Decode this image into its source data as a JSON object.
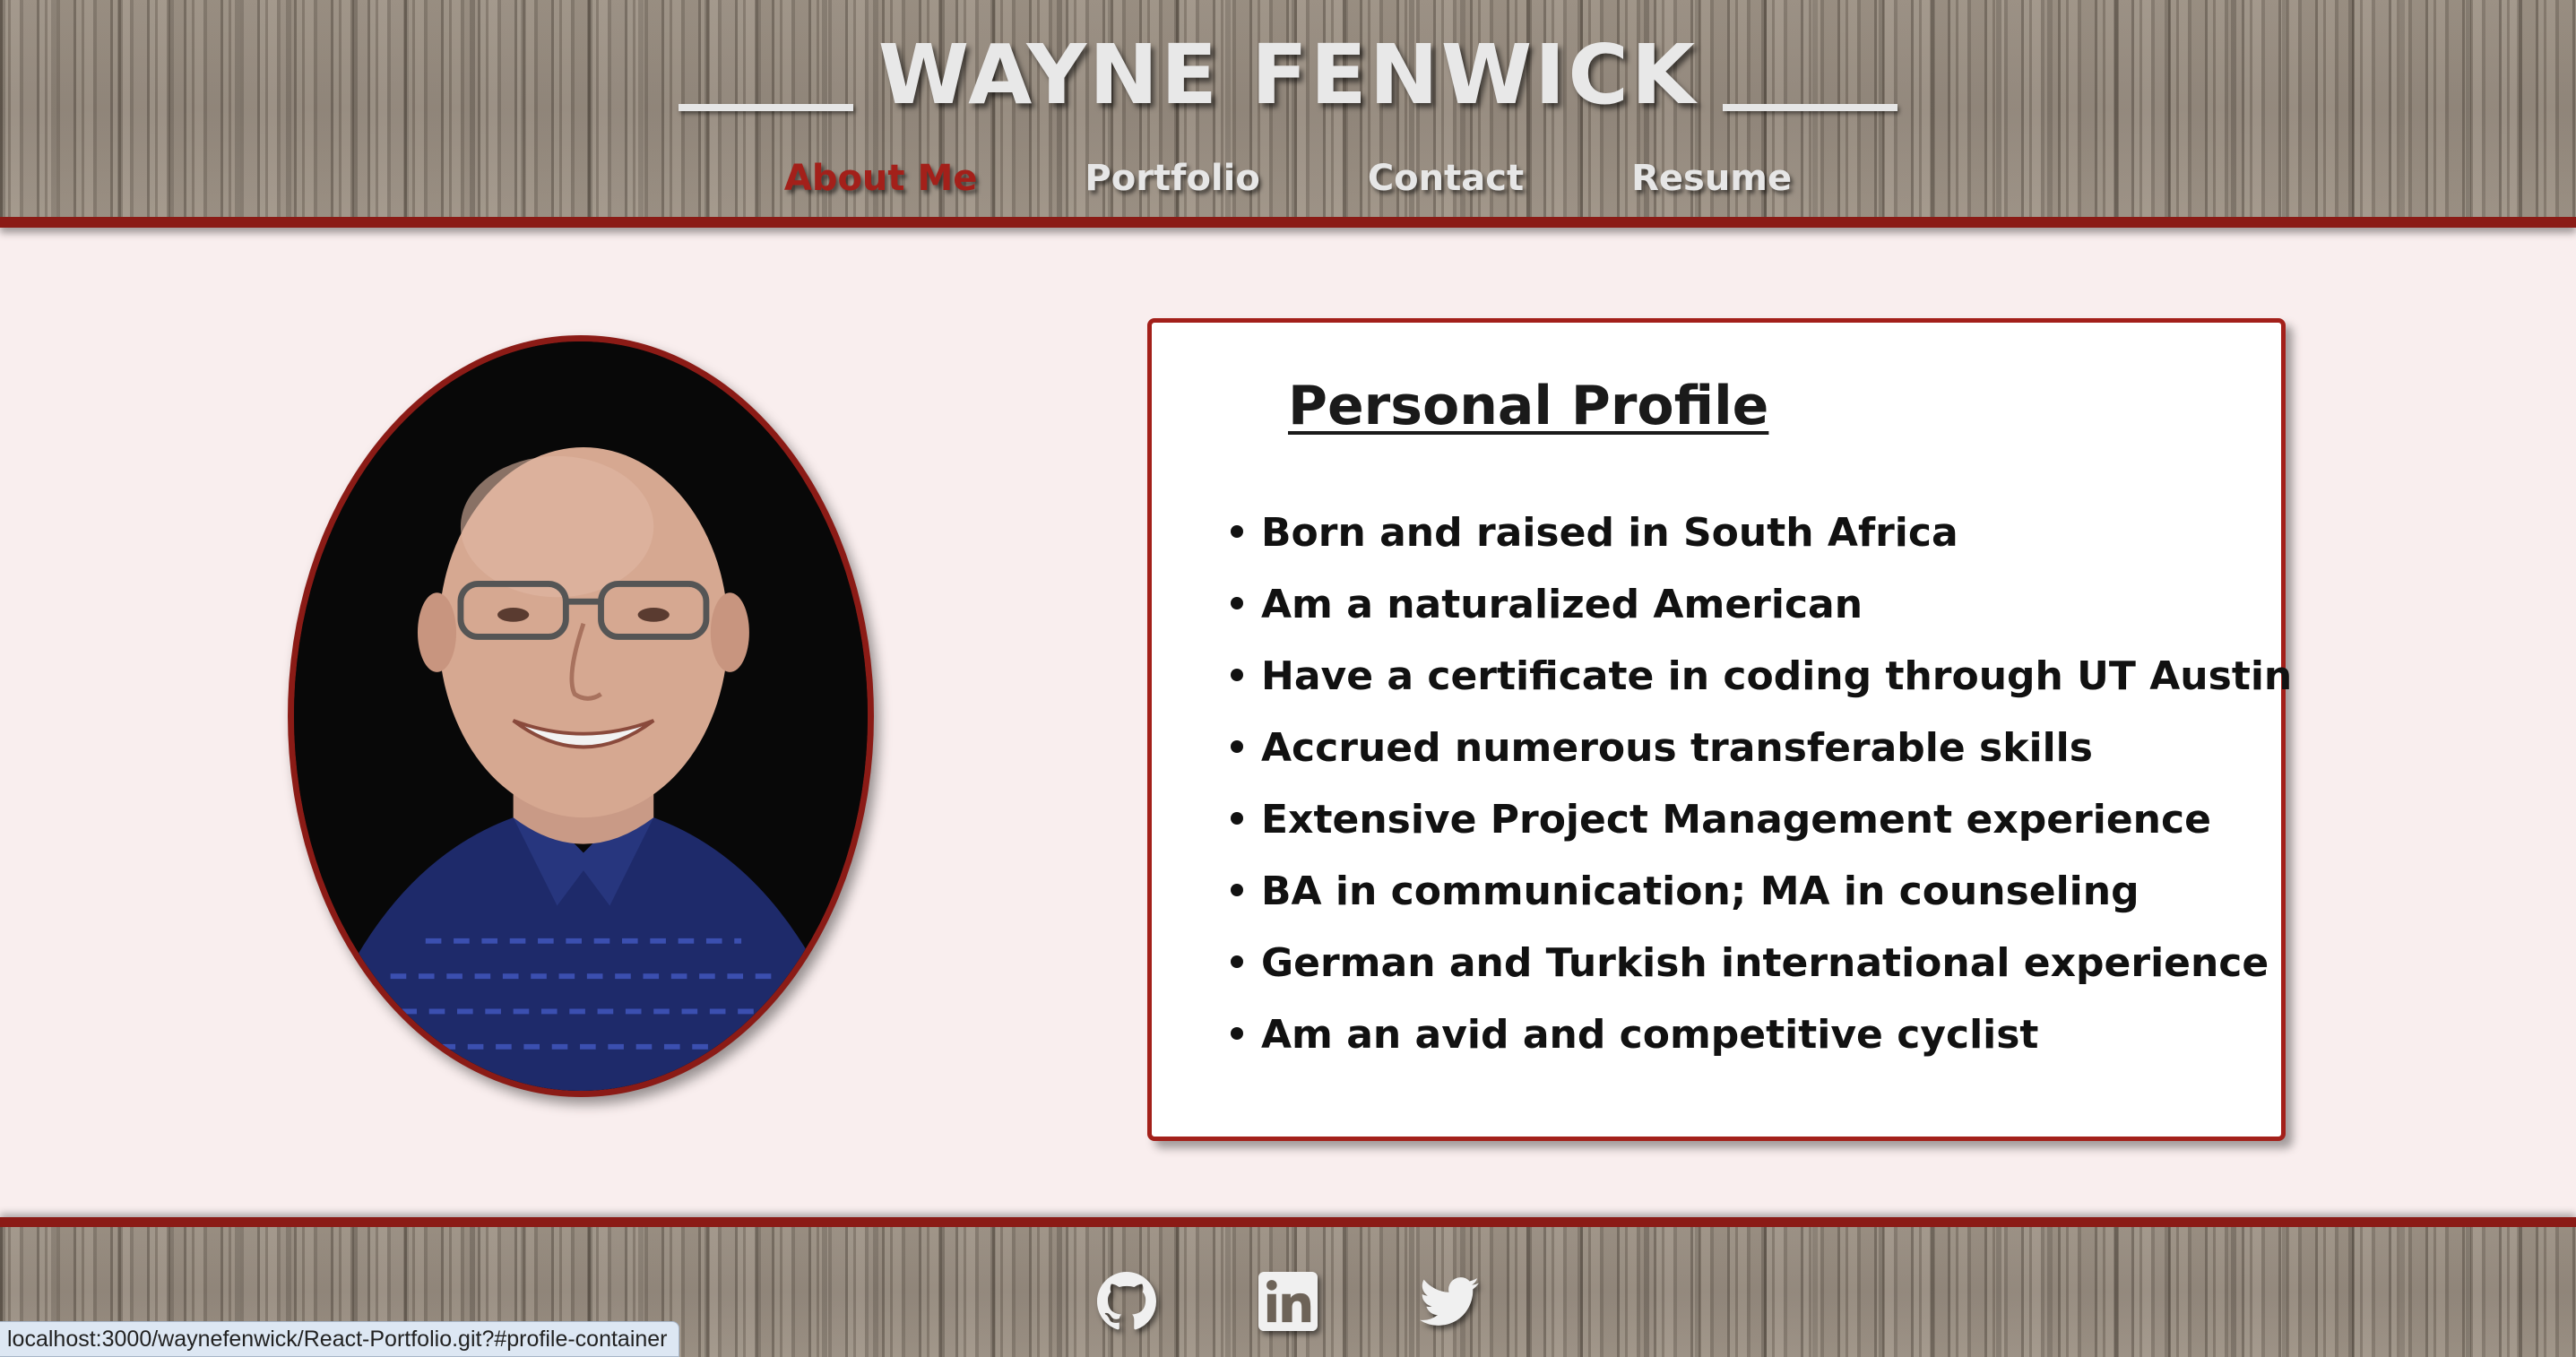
{
  "header": {
    "title": "WAYNE FENWICK",
    "nav": [
      {
        "label": "About Me",
        "active": true
      },
      {
        "label": "Portfolio",
        "active": false
      },
      {
        "label": "Contact",
        "active": false
      },
      {
        "label": "Resume",
        "active": false
      }
    ]
  },
  "profile": {
    "heading": "Personal Profile",
    "items": [
      "Born and raised in South Africa",
      "Am a naturalized American",
      "Have a certificate in coding through UT Austin",
      "Accrued numerous transferable skills",
      "Extensive Project Management experience",
      "BA in communication; MA in counseling",
      "German and Turkish international experience",
      "Am an avid and competitive cyclist"
    ]
  },
  "footer": {
    "social": [
      {
        "icon": "github-icon"
      },
      {
        "icon": "linkedin-icon"
      },
      {
        "icon": "twitter-icon"
      }
    ]
  },
  "status_bar": {
    "url": "localhost:3000/waynefenwick/React-Portfolio.git?#profile-container"
  },
  "colors": {
    "accent": "#8b1b16",
    "active_nav": "#a3201a",
    "page_bg": "#f9eeee",
    "nav_text": "#e6e6e6"
  }
}
